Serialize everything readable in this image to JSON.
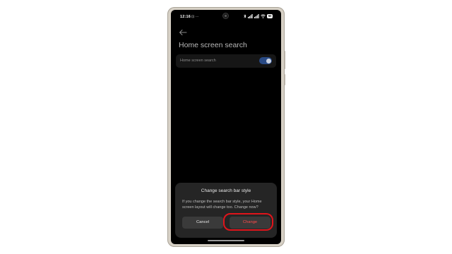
{
  "status_bar": {
    "time": "12:16",
    "notification_glyphs": "⊡ ···",
    "battery": "50"
  },
  "page": {
    "title": "Home screen search"
  },
  "setting": {
    "label": "Home screen search",
    "enabled": true
  },
  "dialog": {
    "title": "Change search bar style",
    "message": "If you change the search bar style, your Home screen layout will change too. Change now?",
    "cancel_label": "Cancel",
    "change_label": "Change"
  },
  "colors": {
    "accent_toggle": "#294a85",
    "destructive_text": "#ff4b4b",
    "highlight_ring": "#e0141b"
  },
  "icons": {
    "back": "back-arrow-icon",
    "bluetooth": "bluetooth-icon",
    "signal": "signal-icon",
    "wifi": "wifi-icon",
    "battery": "battery-icon"
  }
}
